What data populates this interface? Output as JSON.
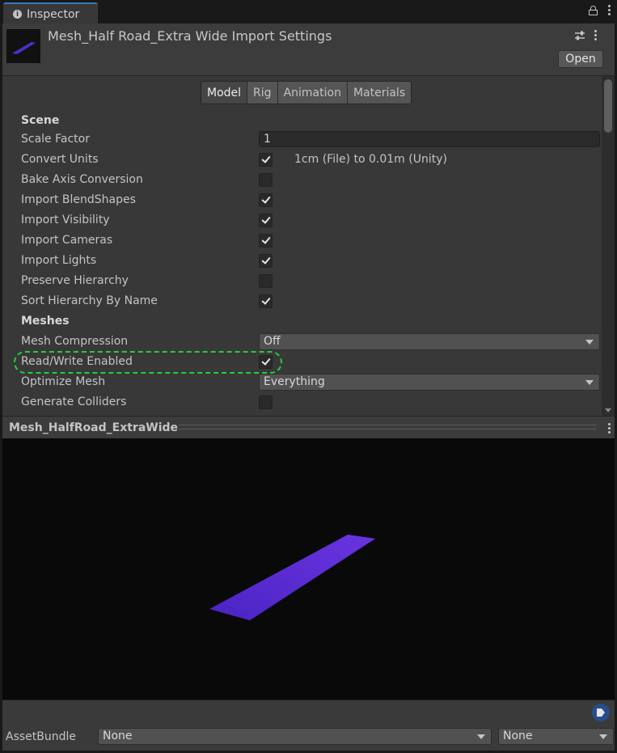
{
  "window": {
    "tab_label": "Inspector",
    "info_glyph": "i"
  },
  "header": {
    "title": "Mesh_Half Road_Extra Wide Import Settings",
    "open_label": "Open",
    "thumbnail_color": "#4f2fd0"
  },
  "tabs": [
    {
      "label": "Model",
      "active": true
    },
    {
      "label": "Rig",
      "active": false
    },
    {
      "label": "Animation",
      "active": false
    },
    {
      "label": "Materials",
      "active": false
    }
  ],
  "scene": {
    "heading": "Scene",
    "scale_factor_label": "Scale Factor",
    "scale_factor_value": "1",
    "convert_units_label": "Convert Units",
    "convert_units_note": "1cm (File) to 0.01m (Unity)",
    "bake_axis_label": "Bake Axis Conversion",
    "blendshapes_label": "Import BlendShapes",
    "visibility_label": "Import Visibility",
    "cameras_label": "Import Cameras",
    "lights_label": "Import Lights",
    "preserve_label": "Preserve Hierarchy",
    "sort_label": "Sort Hierarchy By Name"
  },
  "meshes": {
    "heading": "Meshes",
    "compression_label": "Mesh Compression",
    "compression_value": "Off",
    "readwrite_label": "Read/Write Enabled",
    "optimize_label": "Optimize Mesh",
    "optimize_value": "Everything",
    "colliders_label": "Generate Colliders"
  },
  "checkboxes": {
    "convert_units": true,
    "bake_axis": false,
    "blendshapes": true,
    "visibility": true,
    "cameras": true,
    "lights": true,
    "preserve": false,
    "sort": true,
    "readwrite": true,
    "colliders": false
  },
  "preview": {
    "title": "Mesh_HalfRoad_ExtraWide",
    "mesh_color": "#5428d0"
  },
  "bottom": {
    "assetbundle_label": "AssetBundle",
    "bundle_value": "None",
    "variant_value": "None"
  },
  "colors": {
    "highlight": "#1fd13a",
    "tab_accent": "#3a79bb"
  }
}
